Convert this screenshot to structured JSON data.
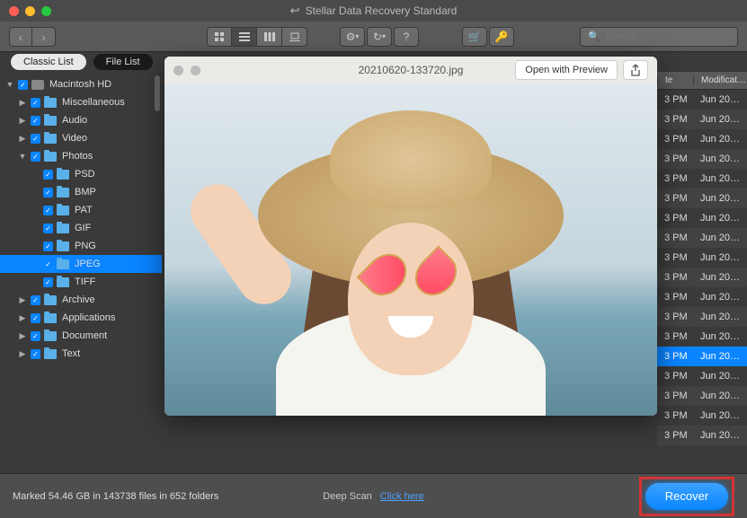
{
  "app": {
    "title": "Stellar Data Recovery Standard"
  },
  "toolbar": {
    "search_placeholder": "Search"
  },
  "tabs": {
    "classic": "Classic List",
    "file": "File List"
  },
  "cols": {
    "date_hdr": "te",
    "mod_hdr": "Modificat…"
  },
  "tree": {
    "root": "Macintosh HD",
    "misc": "Miscellaneous",
    "audio": "Audio",
    "video": "Video",
    "photos": "Photos",
    "psd": "PSD",
    "bmp": "BMP",
    "pat": "PAT",
    "gif": "GIF",
    "png": "PNG",
    "jpeg": "JPEG",
    "tiff": "TIFF",
    "archive": "Archive",
    "applications": "Applications",
    "document": "Document",
    "text": "Text"
  },
  "preview": {
    "filename": "20210620-133720.jpg",
    "open_btn": "Open with Preview"
  },
  "rows": [
    {
      "t": "3 PM",
      "m": "Jun 20…"
    },
    {
      "t": "3 PM",
      "m": "Jun 20…"
    },
    {
      "t": "3 PM",
      "m": "Jun 20…"
    },
    {
      "t": "3 PM",
      "m": "Jun 20…"
    },
    {
      "t": "3 PM",
      "m": "Jun 20…"
    },
    {
      "t": "3 PM",
      "m": "Jun 20…"
    },
    {
      "t": "3 PM",
      "m": "Jun 20…"
    },
    {
      "t": "3 PM",
      "m": "Jun 20…"
    },
    {
      "t": "3 PM",
      "m": "Jun 20…"
    },
    {
      "t": "3 PM",
      "m": "Jun 20…"
    },
    {
      "t": "3 PM",
      "m": "Jun 20…"
    },
    {
      "t": "3 PM",
      "m": "Jun 20…"
    },
    {
      "t": "3 PM",
      "m": "Jun 20…"
    },
    {
      "t": "3 PM",
      "m": "Jun 20…"
    },
    {
      "t": "3 PM",
      "m": "Jun 20…"
    },
    {
      "t": "3 PM",
      "m": "Jun 20…"
    },
    {
      "t": "3 PM",
      "m": "Jun 20…"
    },
    {
      "t": "3 PM",
      "m": "Jun 20…"
    }
  ],
  "footer": {
    "status": "Marked 54.46 GB in 143738 files in 652 folders",
    "deep_label": "Deep Scan",
    "deep_link": "Click here",
    "recover": "Recover"
  }
}
